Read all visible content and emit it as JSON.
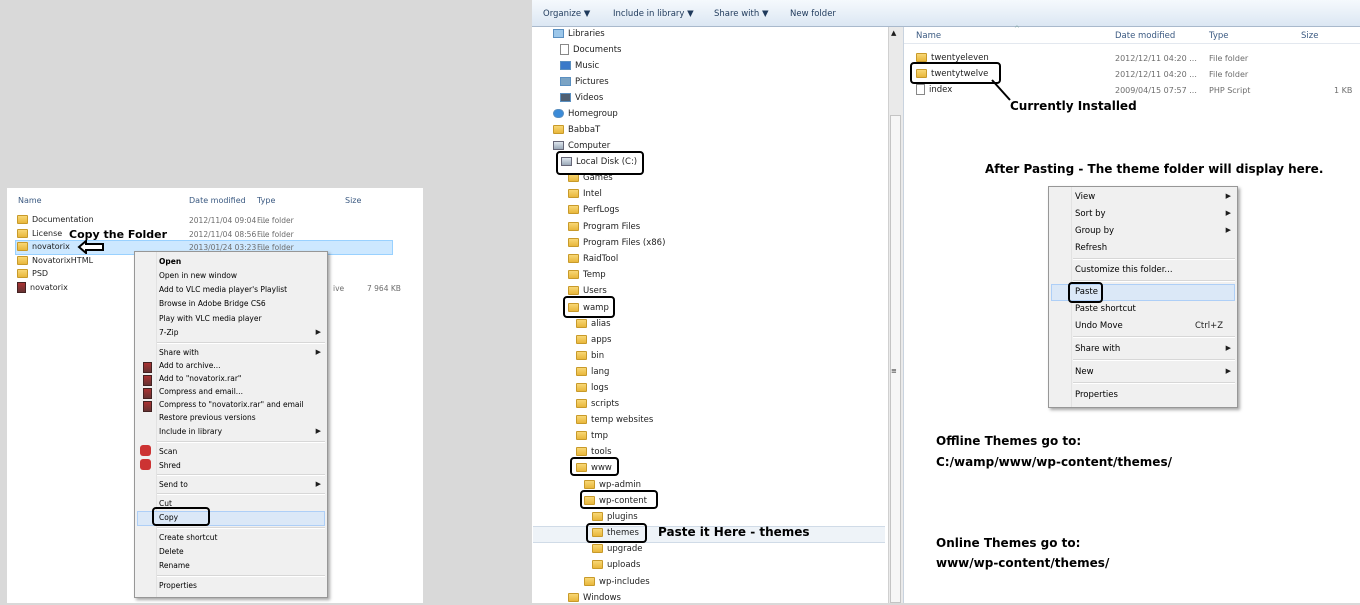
{
  "left_explorer": {
    "columns": {
      "name": "Name",
      "date": "Date modified",
      "type": "Type",
      "size": "Size"
    },
    "rows": [
      {
        "name": "Documentation",
        "date": "2012/11/04 09:04 ...",
        "type": "File folder",
        "size": ""
      },
      {
        "name": "License",
        "date": "2012/11/04 08:56 ...",
        "type": "File folder",
        "size": ""
      },
      {
        "name": "novatorix",
        "date": "2013/01/24 03:23 ...",
        "type": "File folder",
        "size": ""
      },
      {
        "name": "NovatorixHTML",
        "date": "",
        "type": "",
        "size": ""
      },
      {
        "name": "PSD",
        "date": "",
        "type": "",
        "size": ""
      },
      {
        "name": "novatorix",
        "date": "",
        "type": "ive",
        "size": "7 964 KB"
      }
    ],
    "annotation": "Copy the Folder"
  },
  "context_menu": {
    "items": [
      "Open",
      "Open in new window",
      "Add to VLC media player's Playlist",
      "Browse in Adobe Bridge CS6",
      "Play with VLC media player",
      "7-Zip",
      "Share with",
      "Add to archive...",
      "Add to \"novatorix.rar\"",
      "Compress and email...",
      "Compress to \"novatorix.rar\" and email",
      "Restore previous versions",
      "Include in library",
      "Scan",
      "Shred",
      "Send to",
      "Cut",
      "Copy",
      "Create shortcut",
      "Delete",
      "Rename",
      "Properties"
    ]
  },
  "toolbar": {
    "organize": "Organize ▼",
    "include": "Include in library ▼",
    "share": "Share with ▼",
    "new_folder": "New folder"
  },
  "nav_tree": {
    "items": [
      "Libraries",
      "Documents",
      "Music",
      "Pictures",
      "Videos",
      "Homegroup",
      "BabbaT",
      "Computer",
      "Local Disk (C:)",
      "Games",
      "Intel",
      "PerfLogs",
      "Program Files",
      "Program Files (x86)",
      "RaidTool",
      "Temp",
      "Users",
      "wamp",
      "alias",
      "apps",
      "bin",
      "lang",
      "logs",
      "scripts",
      "temp websites",
      "tmp",
      "tools",
      "www",
      "wp-admin",
      "wp-content",
      "plugins",
      "themes",
      "upgrade",
      "uploads",
      "wp-includes",
      "Windows"
    ]
  },
  "content": {
    "columns": {
      "name": "Name",
      "date": "Date modified",
      "type": "Type",
      "size": "Size"
    },
    "rows": [
      {
        "name": "twentyeleven",
        "date": "2012/12/11 04:20 ...",
        "type": "File folder",
        "size": ""
      },
      {
        "name": "twentytwelve",
        "date": "2012/12/11 04:20 ...",
        "type": "File folder",
        "size": ""
      },
      {
        "name": "index",
        "date": "2009/04/15 07:57 ...",
        "type": "PHP Script",
        "size": "1 KB"
      }
    ]
  },
  "content_menu": {
    "items": [
      "View",
      "Sort by",
      "Group by",
      "Refresh",
      "Customize this folder...",
      "Paste",
      "Paste shortcut",
      "Undo Move",
      "Share with",
      "New",
      "Properties"
    ],
    "undo_shortcut": "Ctrl+Z"
  },
  "annotations": {
    "currently_installed": "Currently Installed",
    "after_pasting": "After Pasting - The theme folder will display here.",
    "paste_here": "Paste it Here - themes",
    "offline_1": "Offline Themes go to:",
    "offline_2": "C:/wamp/www/wp-content/themes/",
    "online_1": "Online Themes go to:",
    "online_2": "www/wp-content/themes/"
  }
}
